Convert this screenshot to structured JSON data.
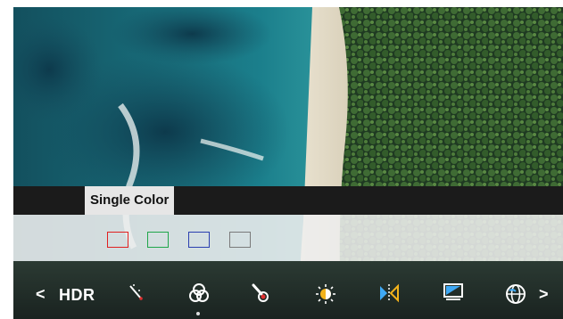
{
  "menu": {
    "tab_label": "Single Color"
  },
  "swatches": [
    {
      "name": "red",
      "color": "#e02020"
    },
    {
      "name": "green",
      "color": "#1fa64a"
    },
    {
      "name": "blue",
      "color": "#2a3fb0"
    },
    {
      "name": "gray",
      "color": "#7a7a7a"
    }
  ],
  "toolbar": {
    "left_arrow": "<",
    "hdr_label": "HDR",
    "right_arrow": ">",
    "icons": [
      "magic-wand-icon",
      "color-circles-icon",
      "color-dropper-icon",
      "brightness-icon",
      "mirror-icon",
      "monitor-icon",
      "globe-icon"
    ],
    "active_icon": "color-circles-icon"
  }
}
